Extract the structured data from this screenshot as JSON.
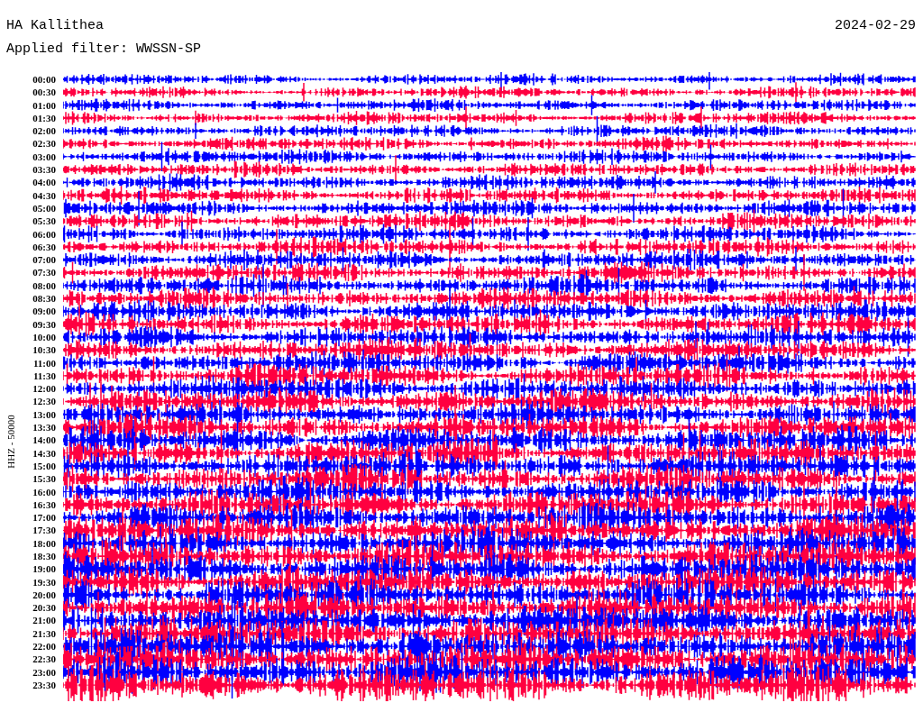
{
  "header": {
    "station": "HA Kallithea",
    "date": "2024-02-29",
    "filter": "Applied filter: WWSSN-SP"
  },
  "axis": {
    "channel_label": "HHZ - 50000"
  },
  "times": [
    "00:00",
    "00:30",
    "01:00",
    "01:30",
    "02:00",
    "02:30",
    "03:00",
    "03:30",
    "04:00",
    "04:30",
    "05:00",
    "05:30",
    "06:00",
    "06:30",
    "07:00",
    "07:30",
    "08:00",
    "08:30",
    "09:00",
    "09:30",
    "10:00",
    "10:30",
    "11:00",
    "11:30",
    "12:00",
    "12:30",
    "13:00",
    "13:30",
    "14:00",
    "14:30",
    "15:00",
    "15:30",
    "16:00",
    "16:30",
    "17:00",
    "17:30",
    "18:00",
    "18:30",
    "19:00",
    "19:30",
    "20:00",
    "20:30",
    "21:00",
    "21:30",
    "22:00",
    "22:30",
    "23:00",
    "23:30"
  ]
}
